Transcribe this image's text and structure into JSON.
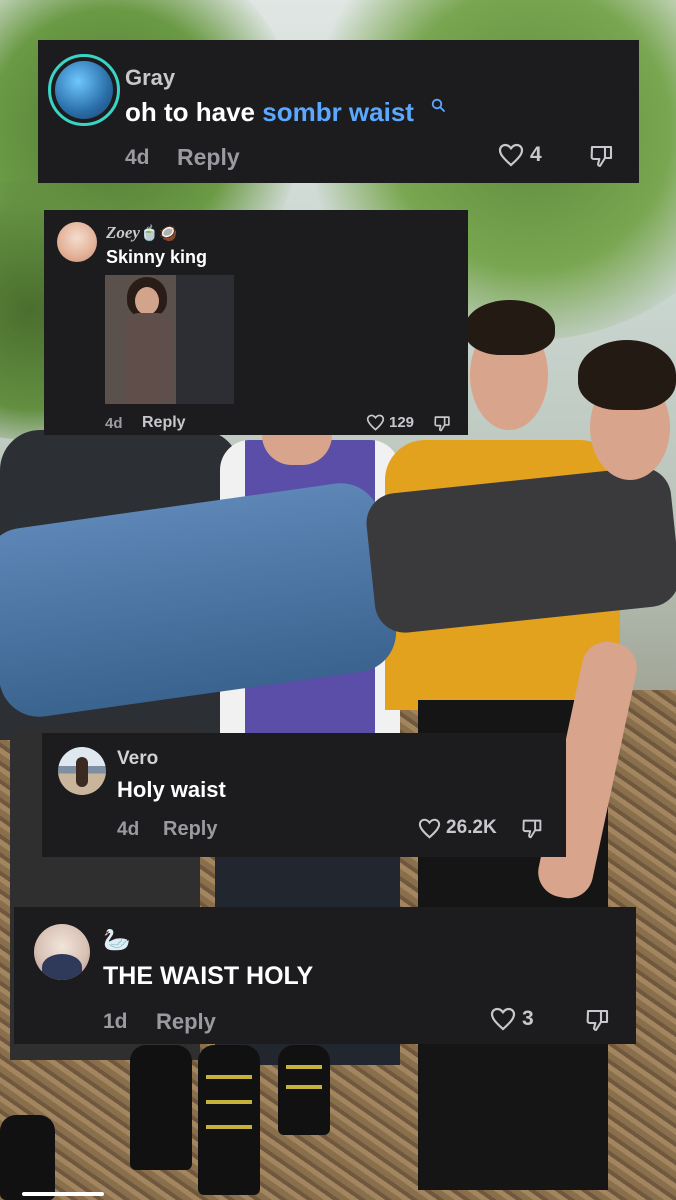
{
  "comments": [
    {
      "username": "Gray",
      "text_plain": "oh to have ",
      "text_highlight": "sombr waist",
      "search_icon": "search-icon",
      "age": "4d",
      "reply_label": "Reply",
      "likes": "4",
      "highlight_color": "#5aa8ff"
    },
    {
      "username": "Zoey",
      "username_emoji": "🍵🥥",
      "text": "Skinny king",
      "age": "4d",
      "reply_label": "Reply",
      "likes": "129"
    },
    {
      "username": "Vero",
      "text": "Holy waist",
      "age": "4d",
      "reply_label": "Reply",
      "likes": "26.2K"
    },
    {
      "username": "🦢",
      "text": "THE WAIST HOLY",
      "age": "1d",
      "reply_label": "Reply",
      "likes": "3"
    }
  ],
  "icons": {
    "like": "heart-icon",
    "dislike": "thumbs-down-icon"
  },
  "colors": {
    "card_bg": "#1c1c1e",
    "avatar_ring": "#3ad3c4"
  },
  "video_progress": 0.12
}
